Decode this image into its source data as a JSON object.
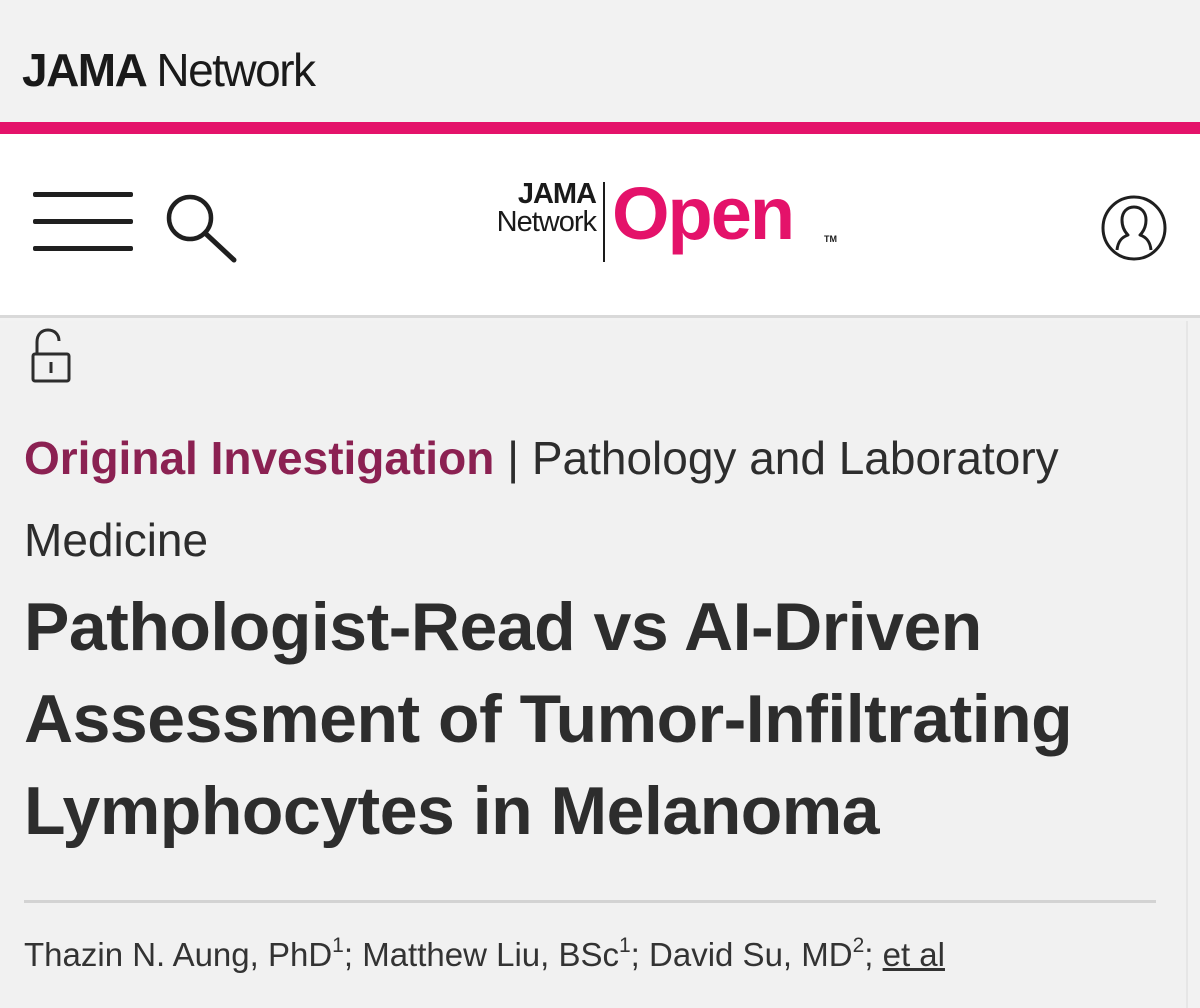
{
  "network_brand": {
    "bold": "JAMA",
    "regular": "Network"
  },
  "colors": {
    "accent": "#e4126a",
    "category": "#8b2152",
    "text": "#2d2d2d",
    "background": "#f2f2f2"
  },
  "nav": {
    "menu_icon": "hamburger-menu-icon",
    "search_icon": "search-icon",
    "account_icon": "user-account-icon",
    "journal_logo": {
      "line1": "JAMA",
      "line2": "Network",
      "name": "Open",
      "tm": "TM"
    }
  },
  "article": {
    "access_icon": "open-access-lock-icon",
    "category_type": "Original Investigation",
    "category_separator": "|",
    "category_subject": "Pathology and Laboratory Medicine",
    "title": "Pathologist-Read vs AI-Driven Assessment of Tumor-Infiltrating Lymphocytes in Melanoma",
    "authors": [
      {
        "name": "Thazin N. Aung, PhD",
        "affiliation": "1"
      },
      {
        "name": "Matthew Liu, BSc",
        "affiliation": "1"
      },
      {
        "name": "David Su, MD",
        "affiliation": "2"
      }
    ],
    "author_separator": ";",
    "et_al": "et al"
  }
}
